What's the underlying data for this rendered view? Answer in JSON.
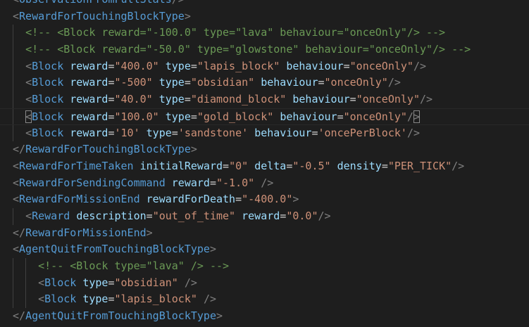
{
  "theme": {
    "background": "#1e1e1e",
    "bracket": "#808080",
    "tag": "#569cd6",
    "attribute": "#9cdcfe",
    "string": "#ce9178",
    "comment": "#6a9955",
    "text": "#d4d4d4"
  },
  "editor": {
    "cursor_line_index": 6,
    "lines": [
      {
        "indent": 0,
        "tokens": [
          [
            "b",
            "<"
          ],
          [
            "t",
            "ObservationFromFullStats"
          ],
          [
            "b",
            "/>"
          ]
        ]
      },
      {
        "indent": 0,
        "tokens": [
          [
            "b",
            "<"
          ],
          [
            "t",
            "RewardForTouchingBlockType"
          ],
          [
            "b",
            ">"
          ]
        ]
      },
      {
        "indent": 1,
        "tokens": [
          [
            "c",
            "<!-- <Block reward=\"-100.0\" type=\"lava\" behaviour=\"onceOnly\"/> -->"
          ]
        ]
      },
      {
        "indent": 1,
        "tokens": [
          [
            "c",
            "<!-- <Block reward=\"-50.0\" type=\"glowstone\" behaviour=\"onceOnly\"/> -->"
          ]
        ]
      },
      {
        "indent": 1,
        "tokens": [
          [
            "b",
            "<"
          ],
          [
            "t",
            "Block"
          ],
          [
            "p",
            " "
          ],
          [
            "a",
            "reward"
          ],
          [
            "e",
            "="
          ],
          [
            "s",
            "\"400.0\""
          ],
          [
            "p",
            " "
          ],
          [
            "a",
            "type"
          ],
          [
            "e",
            "="
          ],
          [
            "s",
            "\"lapis_block\""
          ],
          [
            "p",
            " "
          ],
          [
            "a",
            "behaviour"
          ],
          [
            "e",
            "="
          ],
          [
            "s",
            "\"onceOnly\""
          ],
          [
            "b",
            "/>"
          ]
        ]
      },
      {
        "indent": 1,
        "tokens": [
          [
            "b",
            "<"
          ],
          [
            "t",
            "Block"
          ],
          [
            "p",
            " "
          ],
          [
            "a",
            "reward"
          ],
          [
            "e",
            "="
          ],
          [
            "s",
            "\"-500\""
          ],
          [
            "p",
            " "
          ],
          [
            "a",
            "type"
          ],
          [
            "e",
            "="
          ],
          [
            "s",
            "\"obsidian\""
          ],
          [
            "p",
            " "
          ],
          [
            "a",
            "behaviour"
          ],
          [
            "e",
            "="
          ],
          [
            "s",
            "\"onceOnly\""
          ],
          [
            "b",
            "/>"
          ]
        ]
      },
      {
        "indent": 1,
        "tokens": [
          [
            "b",
            "<"
          ],
          [
            "t",
            "Block"
          ],
          [
            "p",
            " "
          ],
          [
            "a",
            "reward"
          ],
          [
            "e",
            "="
          ],
          [
            "s",
            "\"40.0\""
          ],
          [
            "p",
            " "
          ],
          [
            "a",
            "type"
          ],
          [
            "e",
            "="
          ],
          [
            "s",
            "\"diamond_block\""
          ],
          [
            "p",
            " "
          ],
          [
            "a",
            "behaviour"
          ],
          [
            "e",
            "="
          ],
          [
            "s",
            "\"onceOnly\""
          ],
          [
            "b",
            "/>"
          ]
        ]
      },
      {
        "indent": 1,
        "tokens": [
          [
            "m",
            "<"
          ],
          [
            "t",
            "Block"
          ],
          [
            "p",
            " "
          ],
          [
            "a",
            "reward"
          ],
          [
            "e",
            "="
          ],
          [
            "s",
            "\"100.0\""
          ],
          [
            "p",
            " "
          ],
          [
            "a",
            "type"
          ],
          [
            "e",
            "="
          ],
          [
            "s",
            "\"gold_block\""
          ],
          [
            "p",
            " "
          ],
          [
            "a",
            "behaviour"
          ],
          [
            "e",
            "="
          ],
          [
            "s",
            "\"onceOnly\""
          ],
          [
            "b",
            "/"
          ],
          [
            "m",
            ">"
          ]
        ]
      },
      {
        "indent": 1,
        "tokens": [
          [
            "b",
            "<"
          ],
          [
            "t",
            "Block"
          ],
          [
            "p",
            " "
          ],
          [
            "a",
            "reward"
          ],
          [
            "e",
            "="
          ],
          [
            "s",
            "'10'"
          ],
          [
            "p",
            " "
          ],
          [
            "a",
            "type"
          ],
          [
            "e",
            "="
          ],
          [
            "s",
            "'sandstone'"
          ],
          [
            "p",
            " "
          ],
          [
            "a",
            "behaviour"
          ],
          [
            "e",
            "="
          ],
          [
            "s",
            "'oncePerBlock'"
          ],
          [
            "b",
            "/>"
          ]
        ]
      },
      {
        "indent": 0,
        "tokens": [
          [
            "b",
            "</"
          ],
          [
            "t",
            "RewardForTouchingBlockType"
          ],
          [
            "b",
            ">"
          ]
        ]
      },
      {
        "indent": 0,
        "tokens": [
          [
            "b",
            "<"
          ],
          [
            "t",
            "RewardForTimeTaken"
          ],
          [
            "p",
            " "
          ],
          [
            "a",
            "initialReward"
          ],
          [
            "e",
            "="
          ],
          [
            "s",
            "\"0\""
          ],
          [
            "p",
            " "
          ],
          [
            "a",
            "delta"
          ],
          [
            "e",
            "="
          ],
          [
            "s",
            "\"-0.5\""
          ],
          [
            "p",
            " "
          ],
          [
            "a",
            "density"
          ],
          [
            "e",
            "="
          ],
          [
            "s",
            "\"PER_TICK\""
          ],
          [
            "b",
            "/>"
          ]
        ]
      },
      {
        "indent": 0,
        "tokens": [
          [
            "b",
            "<"
          ],
          [
            "t",
            "RewardForSendingCommand"
          ],
          [
            "p",
            " "
          ],
          [
            "a",
            "reward"
          ],
          [
            "e",
            "="
          ],
          [
            "s",
            "\"-1.0\""
          ],
          [
            "p",
            " "
          ],
          [
            "b",
            "/>"
          ]
        ]
      },
      {
        "indent": 0,
        "tokens": [
          [
            "b",
            "<"
          ],
          [
            "t",
            "RewardForMissionEnd"
          ],
          [
            "p",
            " "
          ],
          [
            "a",
            "rewardForDeath"
          ],
          [
            "e",
            "="
          ],
          [
            "s",
            "\"-400.0\""
          ],
          [
            "b",
            ">"
          ]
        ]
      },
      {
        "indent": 1,
        "tokens": [
          [
            "b",
            "<"
          ],
          [
            "t",
            "Reward"
          ],
          [
            "p",
            " "
          ],
          [
            "a",
            "description"
          ],
          [
            "e",
            "="
          ],
          [
            "s",
            "\"out_of_time\""
          ],
          [
            "p",
            " "
          ],
          [
            "a",
            "reward"
          ],
          [
            "e",
            "="
          ],
          [
            "s",
            "\"0.0\""
          ],
          [
            "b",
            "/>"
          ]
        ]
      },
      {
        "indent": 0,
        "tokens": [
          [
            "b",
            "</"
          ],
          [
            "t",
            "RewardForMissionEnd"
          ],
          [
            "b",
            ">"
          ]
        ]
      },
      {
        "indent": 0,
        "tokens": [
          [
            "b",
            "<"
          ],
          [
            "t",
            "AgentQuitFromTouchingBlockType"
          ],
          [
            "b",
            ">"
          ]
        ]
      },
      {
        "indent": 2,
        "tokens": [
          [
            "c",
            "<!-- <Block type=\"lava\" /> -->"
          ]
        ]
      },
      {
        "indent": 2,
        "tokens": [
          [
            "b",
            "<"
          ],
          [
            "t",
            "Block"
          ],
          [
            "p",
            " "
          ],
          [
            "a",
            "type"
          ],
          [
            "e",
            "="
          ],
          [
            "s",
            "\"obsidian\""
          ],
          [
            "p",
            " "
          ],
          [
            "b",
            "/>"
          ]
        ]
      },
      {
        "indent": 2,
        "tokens": [
          [
            "b",
            "<"
          ],
          [
            "t",
            "Block"
          ],
          [
            "p",
            " "
          ],
          [
            "a",
            "type"
          ],
          [
            "e",
            "="
          ],
          [
            "s",
            "\"lapis_block\""
          ],
          [
            "p",
            " "
          ],
          [
            "b",
            "/>"
          ]
        ]
      },
      {
        "indent": 0,
        "tokens": [
          [
            "b",
            "</"
          ],
          [
            "t",
            "AgentQuitFromTouchingBlockType"
          ],
          [
            "b",
            ">"
          ]
        ]
      }
    ]
  }
}
